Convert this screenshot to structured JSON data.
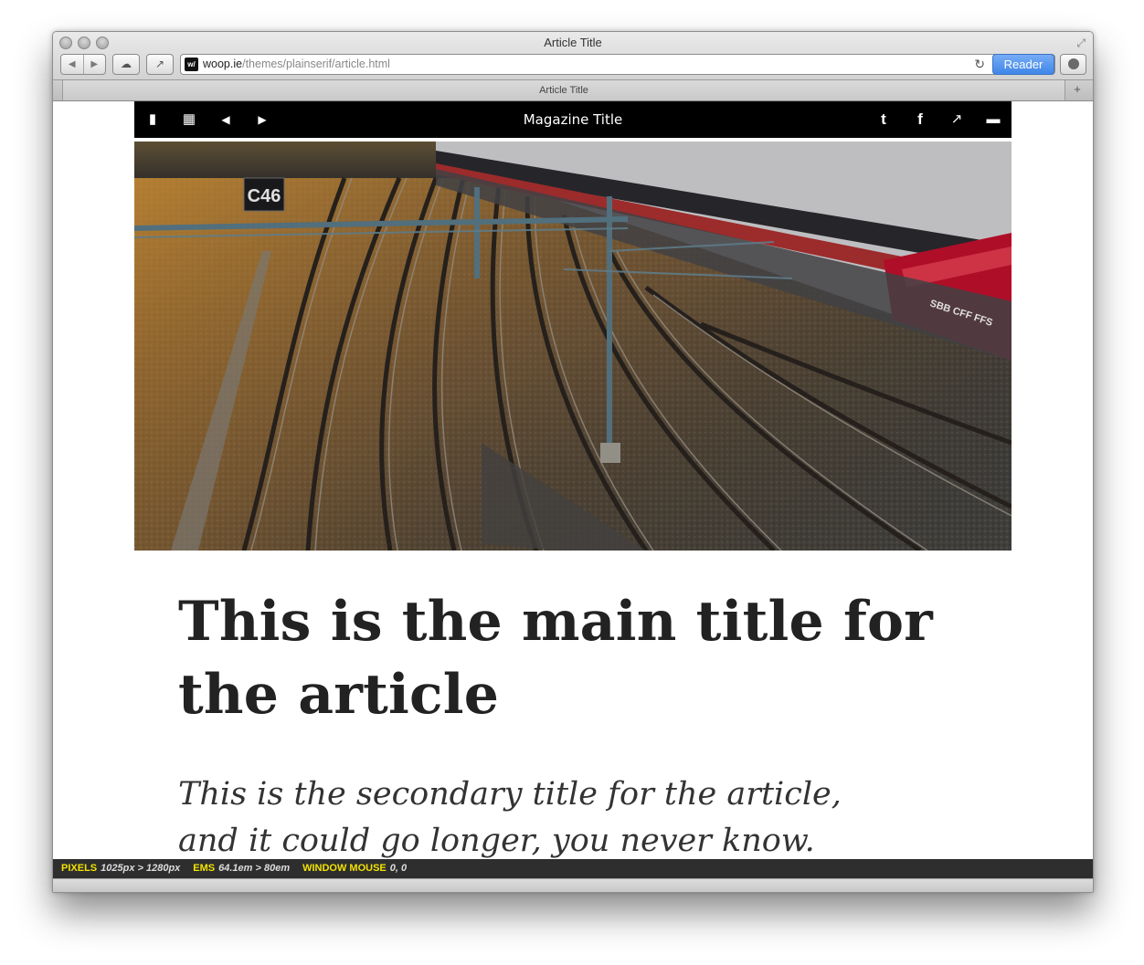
{
  "window": {
    "title": "Article Title",
    "tab_title": "Article Title"
  },
  "toolbar": {
    "back_icon": "◀",
    "forward_icon": "▶",
    "icloud_icon": "☁",
    "share_icon": "↗",
    "url_domain": "woop.ie",
    "url_path": "/themes/plainserif/article.html",
    "favicon_text": "w/",
    "reload_icon": "↻",
    "reader_label": "Reader",
    "newtab_icon": "+",
    "fullscreen_icon": "⤢"
  },
  "magazine_bar": {
    "title": "Magazine Title",
    "icons": {
      "library": "▮",
      "grid": "▦",
      "prev": "◀",
      "next": "▶",
      "twitter": "t",
      "facebook": "f",
      "share": "↗",
      "comment": "▬"
    }
  },
  "article": {
    "title": "This is the main title for the article",
    "subtitle": "This is the secondary title for the article, and it could go longer, you never know."
  },
  "statusbar": {
    "pixels_label": "PIXELS",
    "pixels_value": "1025px > 1280px",
    "ems_label": "EMS",
    "ems_value": "64.1em > 80em",
    "mouse_label": "WINDOW MOUSE",
    "mouse_value": "0, 0"
  },
  "hero_image": {
    "sign_text": "C46",
    "train_marking": "SBB CFF FFS"
  }
}
